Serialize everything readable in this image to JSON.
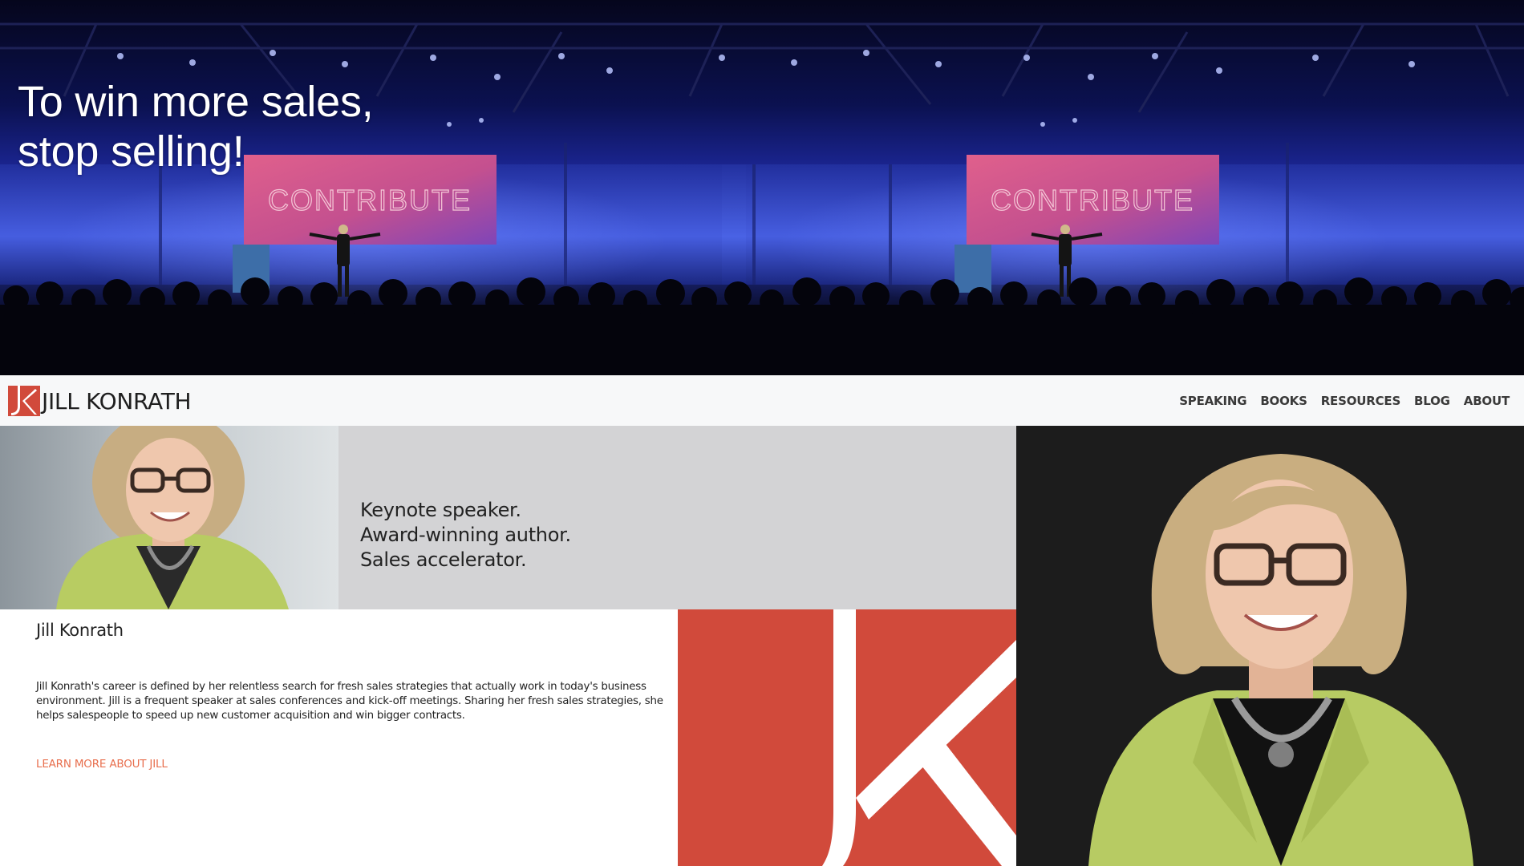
{
  "hero": {
    "headline_line1": "To win more sales,",
    "headline_line2": "stop selling!",
    "screen_text": "CONTRIBUTE",
    "colors": {
      "stage_blue": "#2b3aa8",
      "screen_pink": "#d05a8c",
      "audience": "#05060f"
    }
  },
  "nav": {
    "brand": "JILL KONRATH",
    "brand_color": "#d14a3b",
    "links": [
      "SPEAKING",
      "BOOKS",
      "RESOURCES",
      "BLOG",
      "ABOUT"
    ]
  },
  "tagline": {
    "line1": "Keynote speaker.",
    "line2": "Award-winning author.",
    "line3": "Sales accelerator."
  },
  "bio": {
    "name": "Jill Konrath",
    "text": "Jill Konrath's career is defined by her relentless search for fresh sales strategies that actually work in today's business environment. Jill is a frequent speaker at sales conferences and kick-off meetings. Sharing her fresh sales strategies, she helps salespeople to speed up new customer acquisition and win bigger contracts.",
    "link": "LEARN MORE ABOUT JILL",
    "link_color": "#e86f4e"
  }
}
